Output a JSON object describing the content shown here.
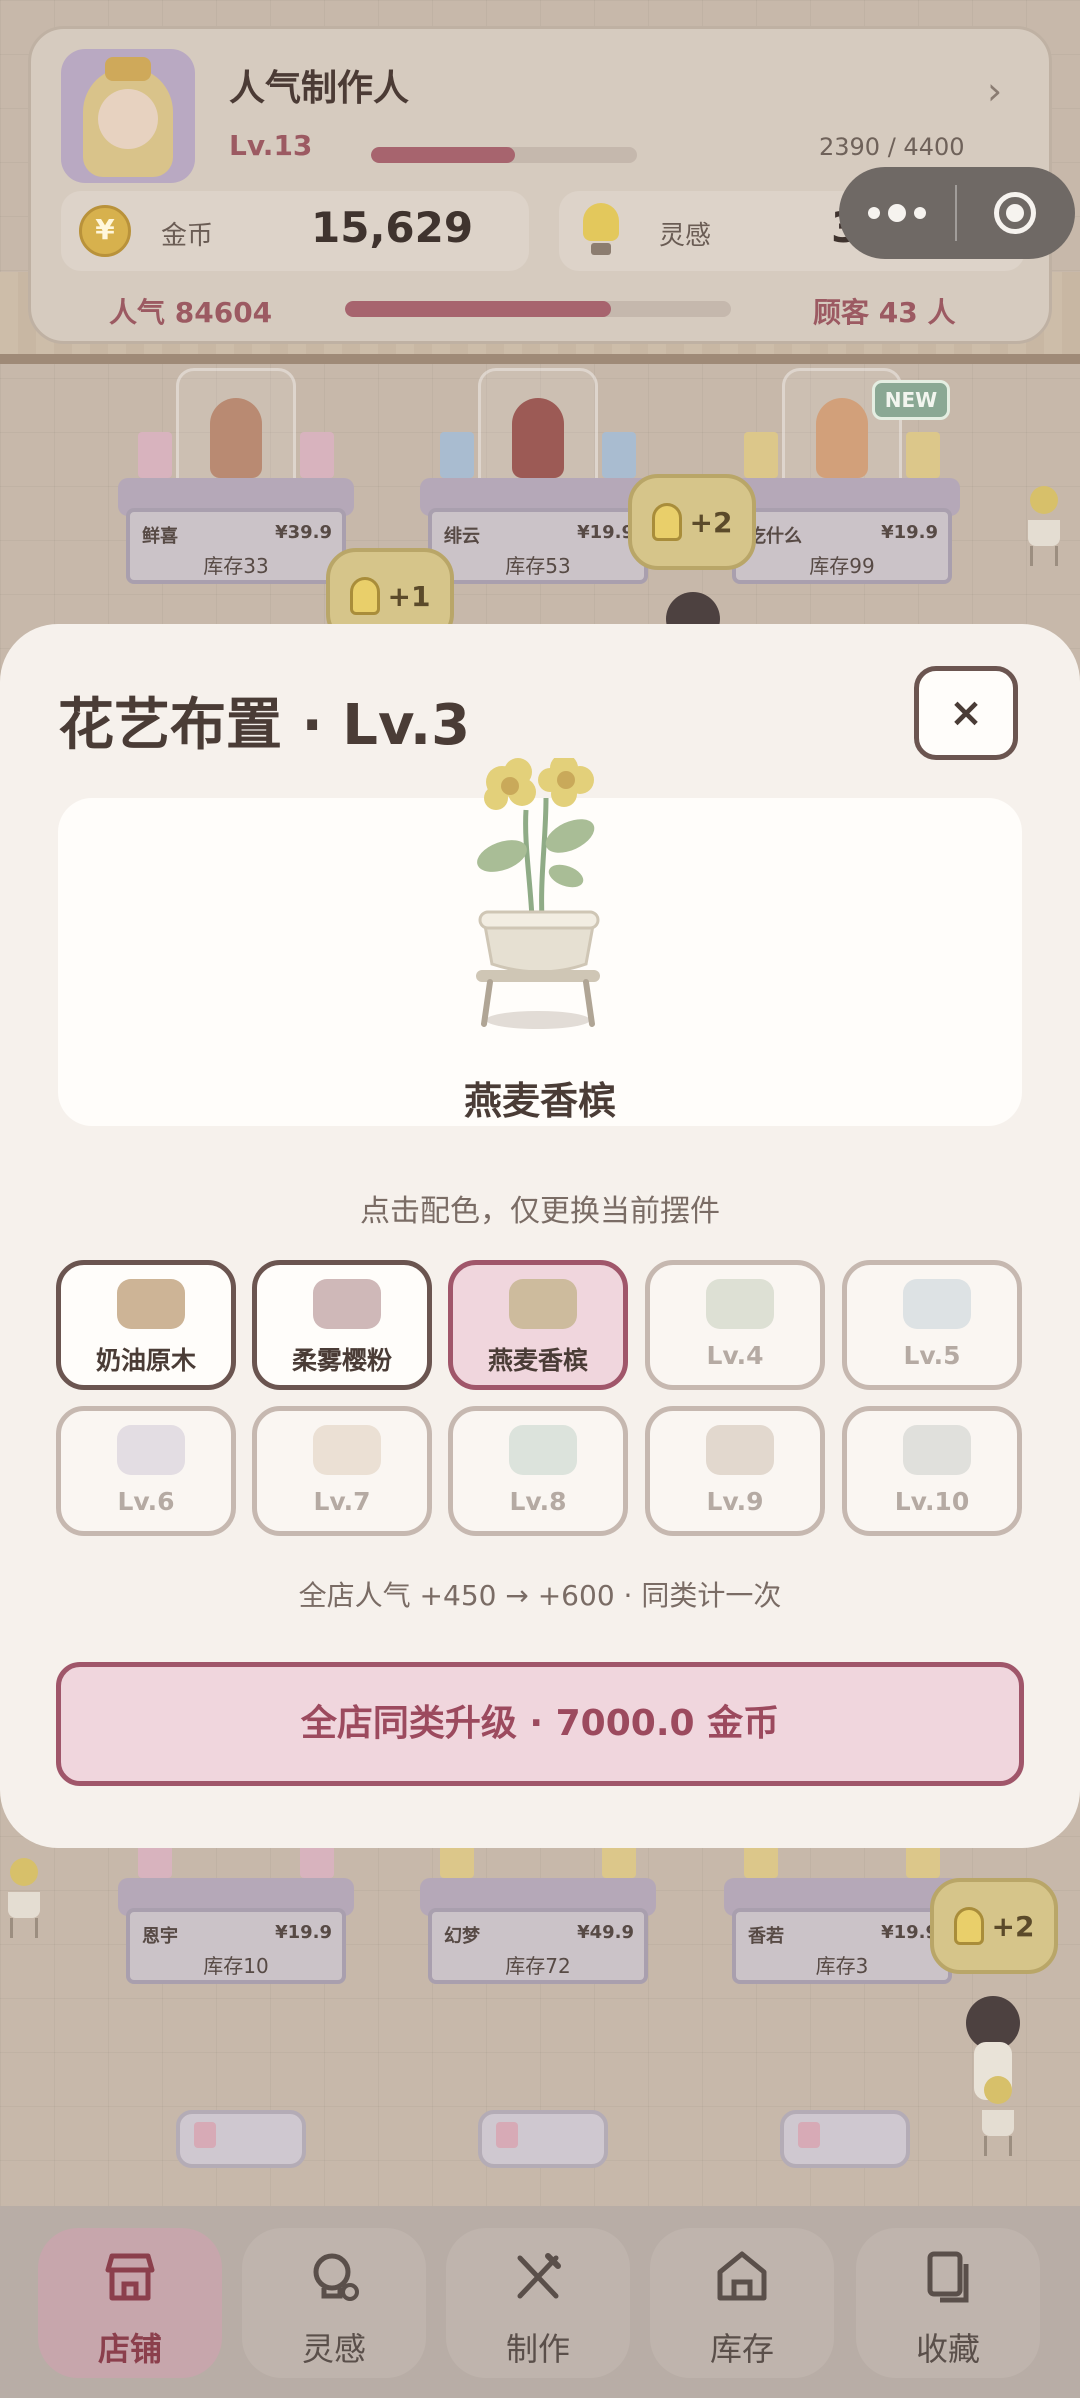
{
  "status": {
    "title": "人气制作人",
    "level": "Lv.13",
    "xp_text": "2390 / 4400",
    "xp_fraction": 0.543,
    "coin_label": "金币",
    "coin_value": "15,629",
    "idea_label": "灵感",
    "idea_value": "304",
    "popularity_text": "人气 84604",
    "popularity_fraction": 0.69,
    "guests_text": "顾客 43 人"
  },
  "coin_glyph": "¥",
  "shelves": [
    {
      "name": "鲜喜",
      "price": "¥39.9",
      "stock": "库存33"
    },
    {
      "name": "绯云",
      "price": "¥19.9",
      "stock": "库存53"
    },
    {
      "name": "吃什么",
      "price": "¥19.9",
      "stock": "库存99"
    },
    {
      "name": "恩宇",
      "price": "¥19.9",
      "stock": "库存10"
    },
    {
      "name": "幻梦",
      "price": "¥49.9",
      "stock": "库存72"
    },
    {
      "name": "香若",
      "price": "¥19.9",
      "stock": "库存3"
    }
  ],
  "new_tag": "NEW",
  "idea_bubbles": [
    "+1",
    "+2",
    "+2"
  ],
  "modal": {
    "title": "花艺布置 · Lv.3",
    "close_glyph": "×",
    "preview_name": "燕麦香槟",
    "hint": "点击配色，仅更换当前摆件",
    "swatches": [
      {
        "label": "奶油原木",
        "color": "#cdb496",
        "state": "unlocked"
      },
      {
        "label": "柔雾樱粉",
        "color": "#cfb8b8",
        "state": "unlocked"
      },
      {
        "label": "燕麦香槟",
        "color": "#cdbb9d",
        "state": "selected"
      },
      {
        "label": "Lv.4",
        "color": "#dde0d4",
        "state": "locked"
      },
      {
        "label": "Lv.5",
        "color": "#dde2e4",
        "state": "locked"
      },
      {
        "label": "Lv.6",
        "color": "#e3dde3",
        "state": "locked"
      },
      {
        "label": "Lv.7",
        "color": "#ebe0d4",
        "state": "locked"
      },
      {
        "label": "Lv.8",
        "color": "#dce3dc",
        "state": "locked"
      },
      {
        "label": "Lv.9",
        "color": "#e2d8ce",
        "state": "locked"
      },
      {
        "label": "Lv.10",
        "color": "#e0e0dc",
        "state": "locked"
      }
    ],
    "bonus": "全店人气 +450 → +600 · 同类计一次",
    "upgrade_button": "全店同类升级 · 7000.0 金币"
  },
  "nav": [
    {
      "label": "店铺",
      "icon": "shop-icon",
      "active": true
    },
    {
      "label": "灵感",
      "icon": "lightbulb-icon",
      "active": false
    },
    {
      "label": "制作",
      "icon": "craft-tools-icon",
      "active": false
    },
    {
      "label": "库存",
      "icon": "warehouse-icon",
      "active": false
    },
    {
      "label": "收藏",
      "icon": "collection-icon",
      "active": false
    }
  ]
}
